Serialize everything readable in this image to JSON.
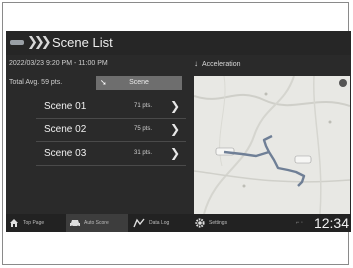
{
  "header": {
    "chevrons": "❯❯❯",
    "title": "Scene List"
  },
  "info": {
    "date_range": "2022/03/23 9:20 PM - 11:00 PM",
    "total_avg": "Total Avg. 59 pts."
  },
  "scene_button": {
    "pointer": "➘",
    "label": "Scene"
  },
  "scenes": [
    {
      "name": "Scene 01",
      "points": "71 pts.",
      "arrow": "❯"
    },
    {
      "name": "Scene 02",
      "points": "75 pts.",
      "arrow": "❯"
    },
    {
      "name": "Scene 03",
      "points": "31 pts.",
      "arrow": "❯"
    }
  ],
  "panel": {
    "icon": "↓",
    "title": "Acceleration"
  },
  "nav": [
    {
      "label": "Top Page",
      "icon": "home-icon"
    },
    {
      "label": "Auto Score",
      "icon": "car-icon",
      "active": true
    },
    {
      "label": "Data Log",
      "icon": "route-icon"
    },
    {
      "label": "Settings",
      "icon": "gear-icon"
    }
  ],
  "status": {
    "signal": "⌐ ◦",
    "clock": "12:34"
  },
  "colors": {
    "screen_bg": "#2a2a2a",
    "route": "#6f7f96",
    "map_bg": "#e8e8e4"
  }
}
